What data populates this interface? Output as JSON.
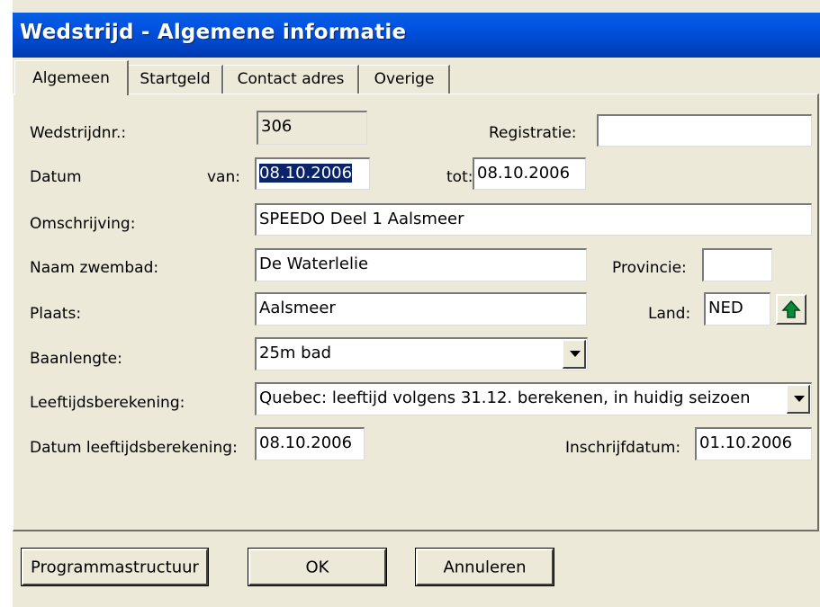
{
  "window": {
    "title": "Wedstrijd - Algemene informatie"
  },
  "tabs": [
    {
      "label": "Algemeen",
      "active": true
    },
    {
      "label": "Startgeld"
    },
    {
      "label": "Contact adres"
    },
    {
      "label": "Overige"
    }
  ],
  "form": {
    "wedstrijdnr_label": "Wedstrijdnr.:",
    "wedstrijdnr_value": "306",
    "registratie_label": "Registratie:",
    "registratie_value": "",
    "datum_label": "Datum",
    "van_label": "van:",
    "van_value": "08.10.2006",
    "tot_label": "tot:",
    "tot_value": "08.10.2006",
    "omschrijving_label": "Omschrijving:",
    "omschrijving_value": "SPEEDO Deel 1 Aalsmeer",
    "naam_zwembad_label": "Naam zwembad:",
    "naam_zwembad_value": "De Waterlelie",
    "provincie_label": "Provincie:",
    "provincie_value": "",
    "plaats_label": "Plaats:",
    "plaats_value": "Aalsmeer",
    "land_label": "Land:",
    "land_value": "NED",
    "baanlengte_label": "Baanlengte:",
    "baanlengte_value": "25m bad",
    "leeftijdsberekening_label": "Leeftijdsberekening:",
    "leeftijdsberekening_value": "Quebec: leeftijd volgens 31.12. berekenen, in huidig seizoen",
    "datum_leeftijdsberekening_label": "Datum leeftijdsberekening:",
    "datum_leeftijdsberekening_value": "08.10.2006",
    "inschrijfdatum_label": "Inschrijfdatum:",
    "inschrijfdatum_value": "01.10.2006"
  },
  "buttons": {
    "programmastructuur": "Programmastructuur",
    "ok": "OK",
    "annuleren": "Annuleren"
  },
  "icons": {
    "land_lookup": "green-up-arrow-icon",
    "combo": "chevron-down-icon"
  },
  "colors": {
    "titlebar": "#0054e3",
    "selection": "#0a246a",
    "face": "#ece9d8"
  }
}
